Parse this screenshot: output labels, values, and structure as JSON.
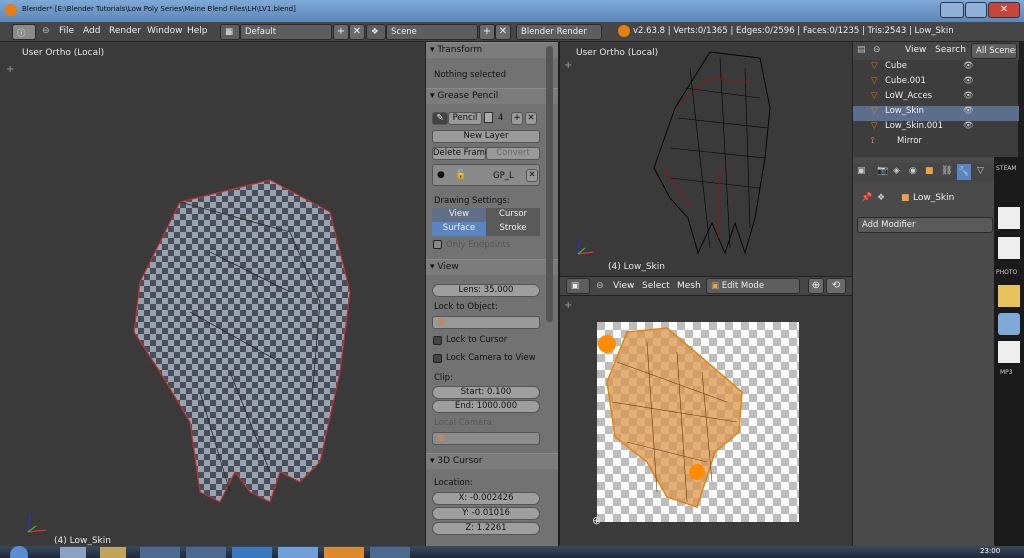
{
  "window": {
    "title": "Blender* [E:\\Blender Tutorials\\Low Poly Series\\Meine Blend Files\\LH\\LV1.blend]"
  },
  "topmenu": {
    "items": [
      "File",
      "Add",
      "Render",
      "Window",
      "Help"
    ],
    "layout": "Default",
    "scene": "Scene",
    "engine": "Blender Render",
    "stats": "v2.63.8 | Verts:0/1365 | Edges:0/2596 | Faces:0/1235 | Tris:2543 | Low_Skin"
  },
  "viewport_left": {
    "label_top": "User Ortho (Local)",
    "label_bottom": "(4) Low_Skin"
  },
  "npanel": {
    "transform": {
      "header": "Transform",
      "status": "Nothing selected"
    },
    "grease": {
      "header": "Grease Pencil",
      "pencil_name": "Pencil",
      "users": "4",
      "new_layer": "New Layer",
      "delete_frame": "Delete Frame",
      "convert": "Convert",
      "layer_name": "GP_L",
      "drawing_settings": "Drawing Settings:",
      "view": "View",
      "cursor": "Cursor",
      "surface": "Surface",
      "stroke": "Stroke",
      "only_endpoints": "Only Endpoints"
    },
    "view": {
      "header": "View",
      "lens": "Lens: 35.000",
      "lock_to_object": "Lock to Object:",
      "lock_to_cursor": "Lock to Cursor",
      "lock_camera": "Lock Camera to View",
      "clip": "Clip:",
      "start": "Start: 0.100",
      "end": "End: 1000.000",
      "local_camera": "Local Camera:"
    },
    "cursor3d": {
      "header": "3D Cursor",
      "location": "Location:",
      "x": "X: -0.002426",
      "y": "Y: -0.01016",
      "z": "Z: 1.2261"
    }
  },
  "viewport_rt": {
    "label_top": "User Ortho (Local)",
    "label_bottom": "(4) Low_Skin"
  },
  "uv_header": {
    "view": "View",
    "select": "Select",
    "mesh": "Mesh",
    "mode": "Edit Mode"
  },
  "outliner": {
    "view": "View",
    "search": "Search",
    "all_scenes": "All Scenes",
    "items": [
      "Cube",
      "Cube.001",
      "LoW_Acces",
      "Low_Skin",
      "Low_Skin.001",
      "Mirror"
    ]
  },
  "properties": {
    "object": "Low_Skin",
    "add_modifier": "Add Modifier"
  },
  "dock": {
    "steam": "STEAM",
    "photo": "PHOTO",
    "mp3": "MP3"
  },
  "taskbar": {
    "clock": "23:00"
  }
}
